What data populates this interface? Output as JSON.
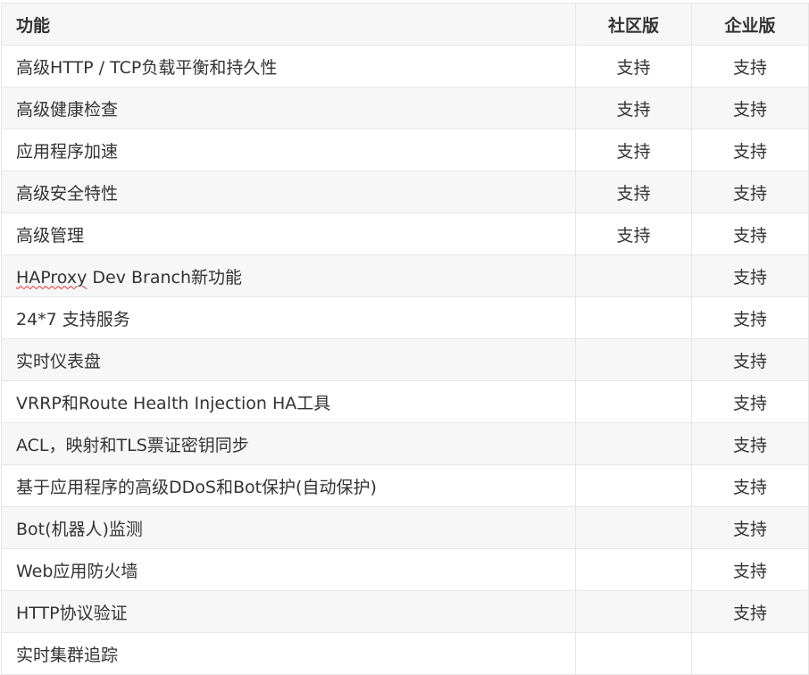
{
  "table": {
    "headers": {
      "feature": "功能",
      "community": "社区版",
      "enterprise": "企业版"
    },
    "rows": [
      {
        "feature": "高级HTTP / TCP负载平衡和持久性",
        "community": "支持",
        "enterprise": "支持"
      },
      {
        "feature": "高级健康检查",
        "community": "支持",
        "enterprise": "支持"
      },
      {
        "feature": "应用程序加速",
        "community": "支持",
        "enterprise": "支持"
      },
      {
        "feature": "高级安全特性",
        "community": "支持",
        "enterprise": "支持"
      },
      {
        "feature": "高级管理",
        "community": "支持",
        "enterprise": "支持"
      },
      {
        "feature_prefix": "HAProxy",
        "feature_suffix": " Dev Branch新功能",
        "community": "",
        "enterprise": "支持"
      },
      {
        "feature": "24*7 支持服务",
        "community": "",
        "enterprise": "支持"
      },
      {
        "feature": "实时仪表盘",
        "community": "",
        "enterprise": "支持"
      },
      {
        "feature": "VRRP和Route Health Injection HA工具",
        "community": "",
        "enterprise": "支持"
      },
      {
        "feature": "ACL，映射和TLS票证密钥同步",
        "community": "",
        "enterprise": "支持"
      },
      {
        "feature": "基于应用程序的高级DDoS和Bot保护(自动保护)",
        "community": "",
        "enterprise": "支持"
      },
      {
        "feature": "Bot(机器人)监测",
        "community": "",
        "enterprise": "支持"
      },
      {
        "feature": "Web应用防火墙",
        "community": "",
        "enterprise": "支持"
      },
      {
        "feature": "HTTP协议验证",
        "community": "",
        "enterprise": "支持"
      },
      {
        "feature": "实时集群追踪",
        "community": "",
        "enterprise": ""
      }
    ]
  }
}
